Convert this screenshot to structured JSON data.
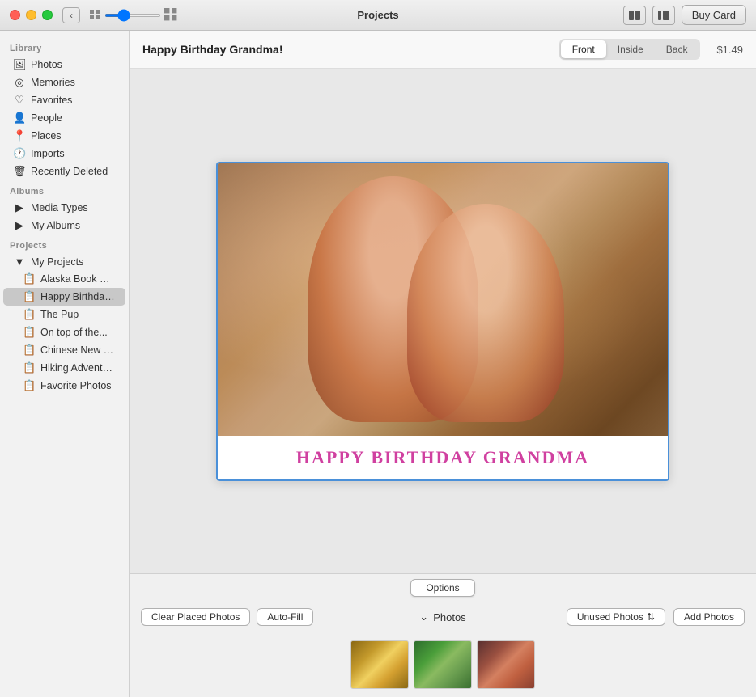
{
  "window": {
    "title": "Projects"
  },
  "titlebar": {
    "back_label": "‹",
    "buy_card_label": "Buy Card"
  },
  "sidebar": {
    "library_label": "Library",
    "albums_label": "Albums",
    "projects_label": "Projects",
    "library_items": [
      {
        "id": "photos",
        "icon": "🖼",
        "label": "Photos"
      },
      {
        "id": "memories",
        "icon": "◎",
        "label": "Memories"
      },
      {
        "id": "favorites",
        "icon": "♡",
        "label": "Favorites"
      },
      {
        "id": "people",
        "icon": "👤",
        "label": "People"
      },
      {
        "id": "places",
        "icon": "📍",
        "label": "Places"
      },
      {
        "id": "imports",
        "icon": "🕐",
        "label": "Imports"
      },
      {
        "id": "recently-deleted",
        "icon": "🗑",
        "label": "Recently Deleted"
      }
    ],
    "album_items": [
      {
        "id": "media-types",
        "icon": "▶",
        "label": "Media Types"
      },
      {
        "id": "my-albums",
        "icon": "▶",
        "label": "My Albums"
      }
    ],
    "project_items": [
      {
        "id": "my-projects",
        "icon": "▼",
        "label": "My Projects",
        "is_group": true
      },
      {
        "id": "alaska-book",
        "icon": "📋",
        "label": "Alaska Book Pr...",
        "indent": true
      },
      {
        "id": "happy-birthday",
        "icon": "📋",
        "label": "Happy Birthday...",
        "indent": true,
        "active": true
      },
      {
        "id": "the-pup",
        "icon": "📋",
        "label": "The Pup",
        "indent": true
      },
      {
        "id": "on-top-of",
        "icon": "📋",
        "label": "On top of the...",
        "indent": true
      },
      {
        "id": "chinese-new",
        "icon": "📋",
        "label": "Chinese New Y...",
        "indent": true
      },
      {
        "id": "hiking-adventure",
        "icon": "📋",
        "label": "Hiking Adventure",
        "indent": true
      },
      {
        "id": "favorite-photos",
        "icon": "📋",
        "label": "Favorite Photos",
        "indent": true
      }
    ]
  },
  "card": {
    "title": "Happy Birthday Grandma!",
    "tabs": [
      {
        "id": "front",
        "label": "Front",
        "active": true
      },
      {
        "id": "inside",
        "label": "Inside"
      },
      {
        "id": "back",
        "label": "Back"
      }
    ],
    "price": "$1.49",
    "bottom_text": "HAPPY BIRTHDAY GRANDMA"
  },
  "bottom": {
    "options_label": "Options",
    "clear_label": "Clear Placed Photos",
    "autofill_label": "Auto-Fill",
    "photos_label": "Photos",
    "unused_label": "Unused Photos",
    "add_label": "Add Photos"
  }
}
